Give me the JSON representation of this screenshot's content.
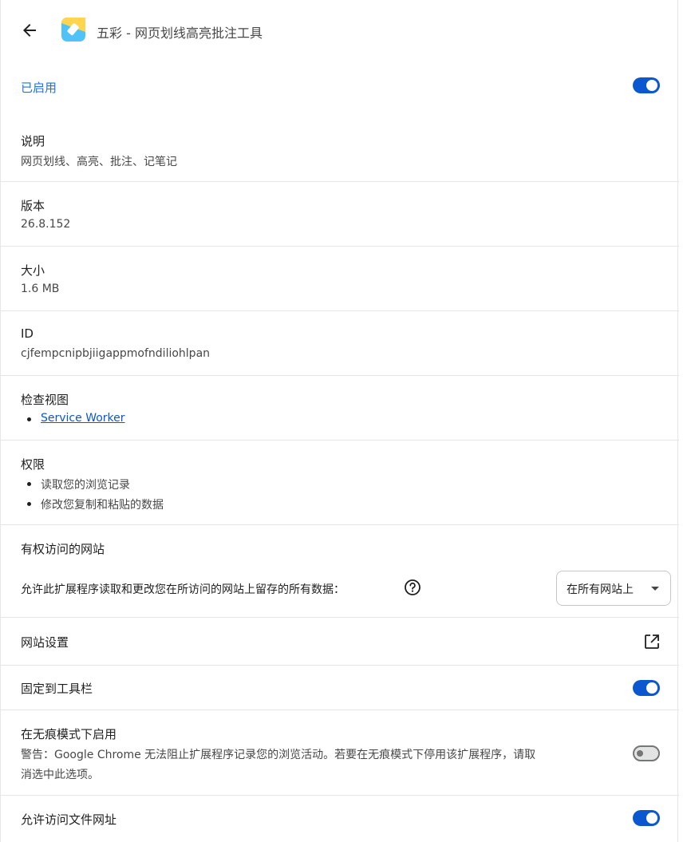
{
  "header": {
    "title": "五彩 - 网页划线高亮批注工具",
    "back_icon": "arrow-back-icon",
    "extension_icon": "wucai-highlighter-icon"
  },
  "enabled": {
    "label": "已启用",
    "on": true
  },
  "description": {
    "label": "说明",
    "value": "网页划线、高亮、批注、记笔记"
  },
  "version": {
    "label": "版本",
    "value": "26.8.152"
  },
  "size": {
    "label": "大小",
    "value": "1.6 MB"
  },
  "id": {
    "label": "ID",
    "value": "cjfempcnipbjiigappmofndiliohlpan"
  },
  "inspect_views": {
    "label": "检查视图",
    "items": [
      "Service Worker"
    ]
  },
  "permissions": {
    "label": "权限",
    "items": [
      "读取您的浏览记录",
      "修改您复制和粘贴的数据"
    ]
  },
  "site_access": {
    "label": "有权访问的网站",
    "description": "允许此扩展程序读取和更改您在所访问的网站上留存的所有数据：",
    "help_icon": "help-circle-icon",
    "selected": "在所有网站上"
  },
  "site_settings": {
    "label": "网站设置",
    "icon": "open-in-new-icon"
  },
  "pin_toolbar": {
    "label": "固定到工具栏",
    "on": true
  },
  "incognito": {
    "label": "在无痕模式下启用",
    "warning_line1": "警告：Google Chrome 无法阻止扩展程序记录您的浏览活动。若要在无痕模式下停用该扩展程序，请取",
    "warning_line2": "消选中此选项。",
    "on": false
  },
  "file_urls": {
    "label": "允许访问文件网址",
    "on": true
  },
  "colors": {
    "accent": "#0b57d0",
    "enabled_text": "#1a73e8",
    "divider": "#e6e6e6"
  }
}
